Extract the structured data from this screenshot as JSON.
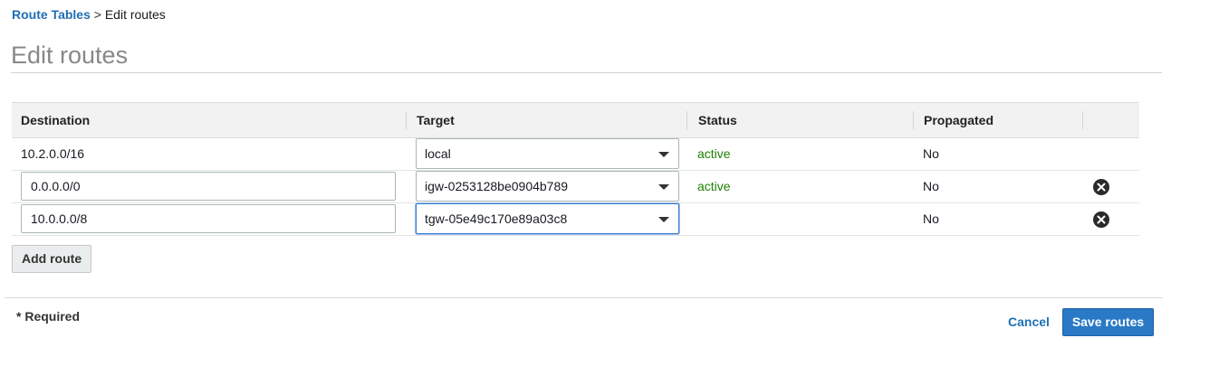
{
  "breadcrumb": {
    "parent": "Route Tables",
    "separator": ">",
    "current": "Edit routes"
  },
  "page_title": "Edit routes",
  "table": {
    "columns": [
      "Destination",
      "Target",
      "Status",
      "Propagated"
    ],
    "rows": [
      {
        "destination": "10.2.0.0/16",
        "target": "local",
        "status": "active",
        "propagated": "No"
      },
      {
        "destination": "0.0.0.0/0",
        "target": "igw-0253128be0904b789",
        "status": "active",
        "propagated": "No"
      },
      {
        "destination": "10.0.0.0/8",
        "target": "tgw-05e49c170e89a03c8",
        "status": "",
        "propagated": "No"
      }
    ]
  },
  "add_route_label": "Add route",
  "required_note": "* Required",
  "cancel_label": "Cancel",
  "save_label": "Save routes",
  "colors": {
    "link": "#1f6fb5",
    "status_active": "#1d8102",
    "primary": "#2a79c6"
  }
}
